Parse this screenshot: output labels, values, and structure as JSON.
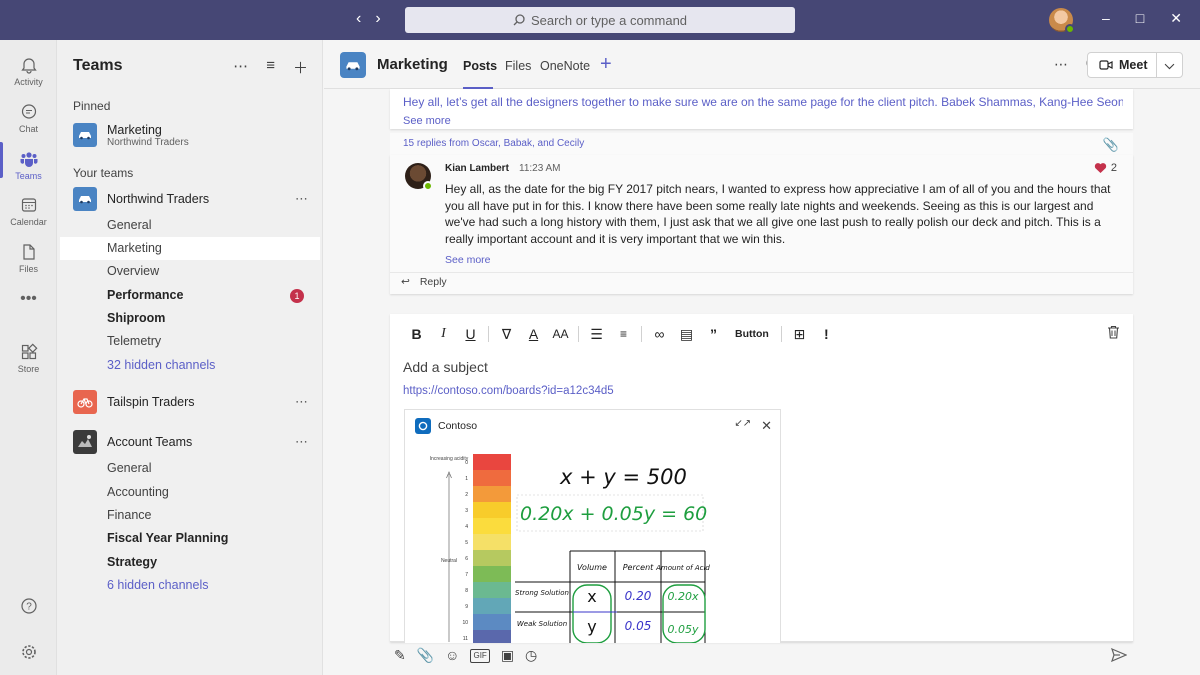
{
  "titlebar": {
    "search_placeholder": "Search or type a command"
  },
  "rail": [
    {
      "label": "Activity",
      "icon": "bell-icon"
    },
    {
      "label": "Chat",
      "icon": "chat-icon"
    },
    {
      "label": "Teams",
      "icon": "teams-icon"
    },
    {
      "label": "Calendar",
      "icon": "calendar-icon"
    },
    {
      "label": "Files",
      "icon": "files-icon"
    },
    {
      "label": "Store",
      "icon": "store-icon"
    }
  ],
  "panel": {
    "title": "Teams",
    "pinned_label": "Pinned",
    "pinned_team": {
      "name": "Marketing",
      "sub": "Northwind Traders"
    },
    "your_teams_label": "Your teams",
    "teams": [
      {
        "name": "Northwind Traders",
        "channels": [
          "General",
          "Marketing",
          "Overview",
          "Performance",
          "Shiproom",
          "Telemetry",
          "32 hidden channels"
        ],
        "badge": "1"
      },
      {
        "name": "Tailspin Traders"
      },
      {
        "name": "Account Teams",
        "channels": [
          "General",
          "Accounting",
          "Finance",
          "Fiscal Year Planning",
          "Strategy",
          "6 hidden channels"
        ]
      }
    ]
  },
  "header": {
    "title": "Marketing",
    "tabs": [
      "Posts",
      "Files",
      "OneNote"
    ],
    "meet_label": "Meet"
  },
  "post": {
    "text": "Hey all, let’s get all the designers together to make sure we are on the same page for the client pitch. Babek Shammas, Kang-Hee Seong,",
    "see_more": "See more",
    "replies": "15 replies from Oscar, Babak, and Cecily"
  },
  "reply": {
    "author": "Kian Lambert",
    "time": "11:23 AM",
    "likes": "2",
    "body": "Hey all, as the date for the big FY 2017 pitch nears, I wanted to express how appreciative I am of all of you and the hours that you all have put in for this. I know there have been some really late nights and weekends. Seeing as this is our largest and we've had such a long history with them, I just ask that we all give one last push to really polish our deck and pitch. This is a really important account and it is very important that we win this.",
    "see_more": "See more",
    "reply_label": "Reply"
  },
  "compose": {
    "button_label": "Button",
    "subject_placeholder": "Add a subject",
    "url": "https://contoso.com/boards?id=a12c34d5",
    "preview_name": "Contoso",
    "whiteboard": {
      "scale_label": "Increasing acidity",
      "neutral_label": "Neutral",
      "scale_numbers": [
        "0",
        "1",
        "2",
        "3",
        "4",
        "5",
        "6",
        "7",
        "8",
        "9",
        "10",
        "11"
      ],
      "eq1": "x + y = 500",
      "eq2": "0.20x + 0.05y = 60",
      "cols": [
        "Volume",
        "Percent",
        "Amount of Acid"
      ],
      "rows": [
        {
          "label": "Strong Solution",
          "cells": [
            "x",
            "0.20",
            "0.20x"
          ]
        },
        {
          "label": "Weak Solution",
          "cells": [
            "y",
            "0.05",
            "0.05y"
          ]
        }
      ]
    }
  },
  "colors": {
    "brand": "#464775",
    "accent": "#5b5fc7",
    "badge": "#c4314b",
    "online": "#6bb700"
  }
}
